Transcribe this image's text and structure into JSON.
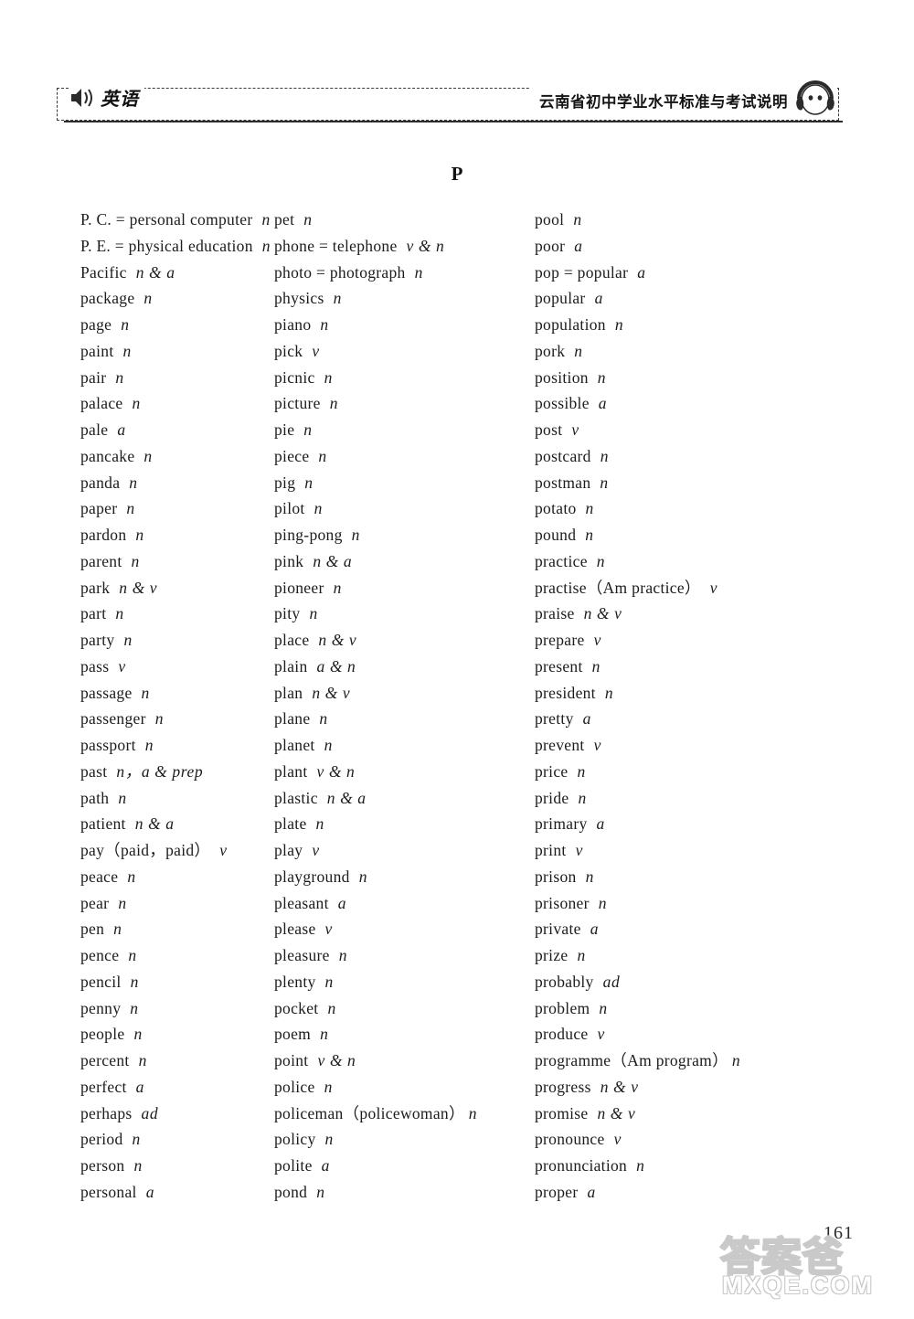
{
  "header": {
    "subject_label": "英语",
    "title": "云南省初中学业水平标准与考试说明",
    "speaker_icon": "speaker-icon",
    "headphone_icon": "headphone-face-icon"
  },
  "section_letter": "P",
  "page_number": "161",
  "watermark": {
    "chinese": "答案爸",
    "domain": "MXQE.COM"
  },
  "columns": [
    {
      "id": "column-1",
      "entries": [
        {
          "headword": "P. C. = personal  computer",
          "pos": "n"
        },
        {
          "headword": "P. E. = physical  education",
          "pos": "n"
        },
        {
          "headword": "Pacific",
          "pos": "n & a"
        },
        {
          "headword": "package",
          "pos": "n"
        },
        {
          "headword": "page",
          "pos": "n"
        },
        {
          "headword": "paint",
          "pos": "n"
        },
        {
          "headword": "pair",
          "pos": "n"
        },
        {
          "headword": "palace",
          "pos": "n"
        },
        {
          "headword": "pale",
          "pos": "a"
        },
        {
          "headword": "pancake",
          "pos": "n"
        },
        {
          "headword": "panda",
          "pos": "n"
        },
        {
          "headword": "paper",
          "pos": "n"
        },
        {
          "headword": "pardon",
          "pos": "n"
        },
        {
          "headword": "parent",
          "pos": "n"
        },
        {
          "headword": "park",
          "pos": "n & v"
        },
        {
          "headword": "part",
          "pos": "n"
        },
        {
          "headword": "party",
          "pos": "n"
        },
        {
          "headword": "pass",
          "pos": "v"
        },
        {
          "headword": "passage",
          "pos": "n"
        },
        {
          "headword": "passenger",
          "pos": "n"
        },
        {
          "headword": "passport",
          "pos": "n"
        },
        {
          "headword": "past",
          "pos": "n，a & prep"
        },
        {
          "headword": "path",
          "pos": "n"
        },
        {
          "headword": "patient",
          "pos": "n & a"
        },
        {
          "headword": "pay（paid，paid）",
          "pos": "v"
        },
        {
          "headword": "peace",
          "pos": "n"
        },
        {
          "headword": "pear",
          "pos": "n"
        },
        {
          "headword": "pen",
          "pos": "n"
        },
        {
          "headword": "pence",
          "pos": "n"
        },
        {
          "headword": "pencil",
          "pos": "n"
        },
        {
          "headword": "penny",
          "pos": "n"
        },
        {
          "headword": "people",
          "pos": "n"
        },
        {
          "headword": "percent",
          "pos": "n"
        },
        {
          "headword": "perfect",
          "pos": "a"
        },
        {
          "headword": "perhaps",
          "pos": "ad"
        },
        {
          "headword": "period",
          "pos": "n"
        },
        {
          "headword": "person",
          "pos": "n"
        },
        {
          "headword": "personal",
          "pos": "a"
        }
      ]
    },
    {
      "id": "column-2",
      "entries": [
        {
          "headword": "pet",
          "pos": "n"
        },
        {
          "headword": "phone = telephone",
          "pos": "v & n"
        },
        {
          "headword": "photo = photograph",
          "pos": "n"
        },
        {
          "headword": "physics",
          "pos": "n"
        },
        {
          "headword": "piano",
          "pos": "n"
        },
        {
          "headword": "pick",
          "pos": "v"
        },
        {
          "headword": "picnic",
          "pos": "n"
        },
        {
          "headword": "picture",
          "pos": "n"
        },
        {
          "headword": "pie",
          "pos": "n"
        },
        {
          "headword": "piece",
          "pos": "n"
        },
        {
          "headword": "pig",
          "pos": "n"
        },
        {
          "headword": "pilot",
          "pos": "n"
        },
        {
          "headword": "ping-pong",
          "pos": "n"
        },
        {
          "headword": "pink",
          "pos": "n & a"
        },
        {
          "headword": "pioneer",
          "pos": "n"
        },
        {
          "headword": "pity",
          "pos": "n"
        },
        {
          "headword": "place",
          "pos": "n & v"
        },
        {
          "headword": "plain",
          "pos": "a & n"
        },
        {
          "headword": "plan",
          "pos": "n & v"
        },
        {
          "headword": "plane",
          "pos": "n"
        },
        {
          "headword": "planet",
          "pos": "n"
        },
        {
          "headword": "plant",
          "pos": "v & n"
        },
        {
          "headword": "plastic",
          "pos": "n & a"
        },
        {
          "headword": "plate",
          "pos": "n"
        },
        {
          "headword": "play",
          "pos": "v"
        },
        {
          "headword": "playground",
          "pos": "n"
        },
        {
          "headword": "pleasant",
          "pos": "a"
        },
        {
          "headword": "please",
          "pos": "v"
        },
        {
          "headword": "pleasure",
          "pos": "n"
        },
        {
          "headword": "plenty",
          "pos": "n"
        },
        {
          "headword": "pocket",
          "pos": "n"
        },
        {
          "headword": "poem",
          "pos": "n"
        },
        {
          "headword": "point",
          "pos": "v & n"
        },
        {
          "headword": "police",
          "pos": "n"
        },
        {
          "headword": "policeman（policewoman）",
          "pos": "n",
          "tight": true
        },
        {
          "headword": "policy",
          "pos": "n"
        },
        {
          "headword": "polite",
          "pos": "a"
        },
        {
          "headword": "pond",
          "pos": "n"
        }
      ]
    },
    {
      "id": "column-3",
      "entries": [
        {
          "headword": "pool",
          "pos": "n"
        },
        {
          "headword": "poor",
          "pos": "a"
        },
        {
          "headword": "pop = popular",
          "pos": "a"
        },
        {
          "headword": "popular",
          "pos": "a"
        },
        {
          "headword": "population",
          "pos": "n"
        },
        {
          "headword": "pork",
          "pos": "n"
        },
        {
          "headword": "position",
          "pos": "n"
        },
        {
          "headword": "possible",
          "pos": "a"
        },
        {
          "headword": "post",
          "pos": "v"
        },
        {
          "headword": "postcard",
          "pos": "n"
        },
        {
          "headword": "postman",
          "pos": "n"
        },
        {
          "headword": "potato",
          "pos": "n"
        },
        {
          "headword": "pound",
          "pos": "n"
        },
        {
          "headword": "practice",
          "pos": "n"
        },
        {
          "headword": "practise（Am practice）",
          "pos": "v"
        },
        {
          "headword": "praise",
          "pos": "n & v"
        },
        {
          "headword": "prepare",
          "pos": "v"
        },
        {
          "headword": "present",
          "pos": "n"
        },
        {
          "headword": "president",
          "pos": "n"
        },
        {
          "headword": "pretty",
          "pos": "a"
        },
        {
          "headword": "prevent",
          "pos": "v"
        },
        {
          "headword": "price",
          "pos": "n"
        },
        {
          "headword": "pride",
          "pos": "n"
        },
        {
          "headword": "primary",
          "pos": "a"
        },
        {
          "headword": "print",
          "pos": "v"
        },
        {
          "headword": "prison",
          "pos": "n"
        },
        {
          "headword": "prisoner",
          "pos": "n"
        },
        {
          "headword": "private",
          "pos": "a"
        },
        {
          "headword": "prize",
          "pos": "n"
        },
        {
          "headword": "probably",
          "pos": "ad"
        },
        {
          "headword": "problem",
          "pos": "n"
        },
        {
          "headword": "produce",
          "pos": "v"
        },
        {
          "headword": "programme（Am program）",
          "pos": "n",
          "tight": true
        },
        {
          "headword": "progress",
          "pos": "n & v"
        },
        {
          "headword": "promise",
          "pos": "n & v"
        },
        {
          "headword": "pronounce",
          "pos": "v"
        },
        {
          "headword": "pronunciation",
          "pos": "n"
        },
        {
          "headword": "proper",
          "pos": "a"
        }
      ]
    }
  ]
}
